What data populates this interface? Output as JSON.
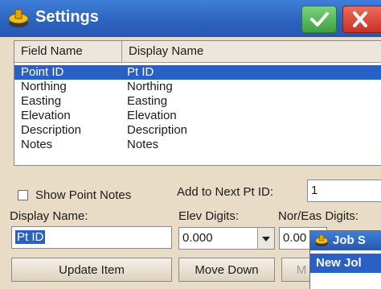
{
  "window": {
    "title": "Settings",
    "ok_icon": "checkmark-icon",
    "close_icon": "close-icon",
    "accent": "#2a5fc4"
  },
  "list": {
    "headers": [
      "Field Name",
      "Display Name"
    ],
    "rows": [
      {
        "field": "Point ID",
        "display": "Pt ID",
        "selected": true
      },
      {
        "field": "Northing",
        "display": "Northing",
        "selected": false
      },
      {
        "field": "Easting",
        "display": "Easting",
        "selected": false
      },
      {
        "field": "Elevation",
        "display": "Elevation",
        "selected": false
      },
      {
        "field": "Description",
        "display": "Description",
        "selected": false
      },
      {
        "field": "Notes",
        "display": "Notes",
        "selected": false
      }
    ]
  },
  "options": {
    "show_point_notes_label": "Show Point Notes",
    "show_point_notes_checked": false,
    "add_to_next_label": "Add to Next Pt ID:",
    "add_to_next_value": "1",
    "display_name_label": "Display Name:",
    "display_name_value": "Pt ID",
    "elev_digits_label": "Elev Digits:",
    "elev_digits_value": "0.000",
    "nor_eas_label": "Nor/Eas Digits:",
    "nor_eas_value": "0.00"
  },
  "buttons": {
    "update_item": "Update Item",
    "move_down": "Move Down",
    "move_up": "M"
  },
  "popup": {
    "title": "Job S",
    "item": "New Jol"
  }
}
